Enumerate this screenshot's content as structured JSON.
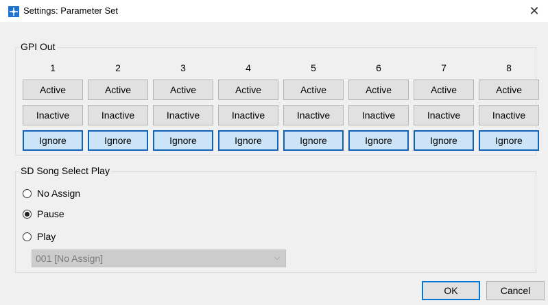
{
  "window": {
    "title": "Settings: Parameter Set",
    "close_glyph": "✕",
    "app_icon": "app-icon"
  },
  "gpi_out": {
    "label": "GPI Out",
    "columns": [
      {
        "number": "1",
        "active": "Active",
        "inactive": "Inactive",
        "ignore": "Ignore",
        "selected": "ignore"
      },
      {
        "number": "2",
        "active": "Active",
        "inactive": "Inactive",
        "ignore": "Ignore",
        "selected": "ignore"
      },
      {
        "number": "3",
        "active": "Active",
        "inactive": "Inactive",
        "ignore": "Ignore",
        "selected": "ignore"
      },
      {
        "number": "4",
        "active": "Active",
        "inactive": "Inactive",
        "ignore": "Ignore",
        "selected": "ignore"
      },
      {
        "number": "5",
        "active": "Active",
        "inactive": "Inactive",
        "ignore": "Ignore",
        "selected": "ignore"
      },
      {
        "number": "6",
        "active": "Active",
        "inactive": "Inactive",
        "ignore": "Ignore",
        "selected": "ignore"
      },
      {
        "number": "7",
        "active": "Active",
        "inactive": "Inactive",
        "ignore": "Ignore",
        "selected": "ignore"
      },
      {
        "number": "8",
        "active": "Active",
        "inactive": "Inactive",
        "ignore": "Ignore",
        "selected": "ignore"
      }
    ]
  },
  "sd_song": {
    "label": "SD Song Select Play",
    "options": [
      {
        "label": "No Assign",
        "checked": false
      },
      {
        "label": "Pause",
        "checked": true
      },
      {
        "label": "Play",
        "checked": false
      }
    ],
    "song_select": {
      "value": "001 [No Assign]",
      "disabled": true
    }
  },
  "buttons": {
    "ok": "OK",
    "cancel": "Cancel"
  },
  "colors": {
    "selected_bg": "#cce4f7",
    "selected_border": "#0f62b8",
    "accent": "#0078d7"
  }
}
